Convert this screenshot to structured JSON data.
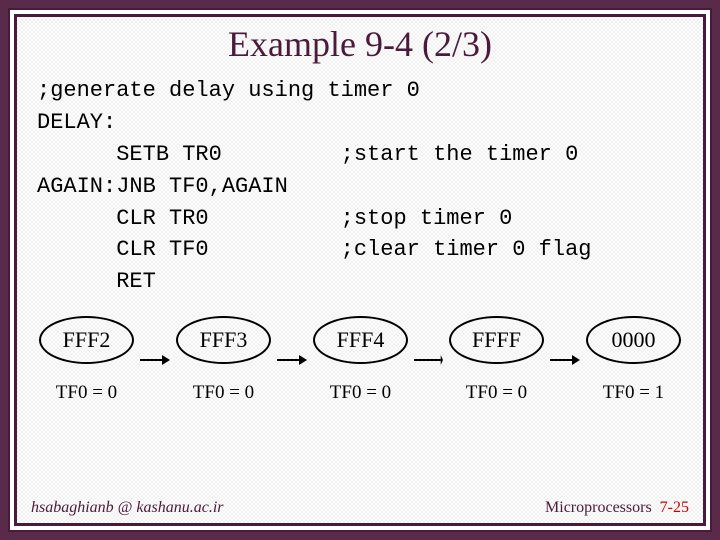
{
  "title": "Example 9-4 (2/3)",
  "code": {
    "l1": ";generate delay using timer 0",
    "l2": "DELAY:",
    "l3": "      SETB TR0         ;start the timer 0",
    "l4": "AGAIN:JNB TF0,AGAIN",
    "l5": "      CLR TR0          ;stop timer 0",
    "l6": "      CLR TF0          ;clear timer 0 flag",
    "l7": "      RET"
  },
  "states": [
    {
      "value": "FFF2",
      "tf": "TF0 = 0"
    },
    {
      "value": "FFF3",
      "tf": "TF0 = 0"
    },
    {
      "value": "FFF4",
      "tf": "TF0 = 0"
    },
    {
      "value": "FFFF",
      "tf": "TF0 = 0"
    },
    {
      "value": "0000",
      "tf": "TF0 = 1"
    }
  ],
  "footer": {
    "left": "hsabaghianb @ kashanu.ac.ir",
    "right_label": "Microprocessors",
    "pagenum": "7-25"
  }
}
